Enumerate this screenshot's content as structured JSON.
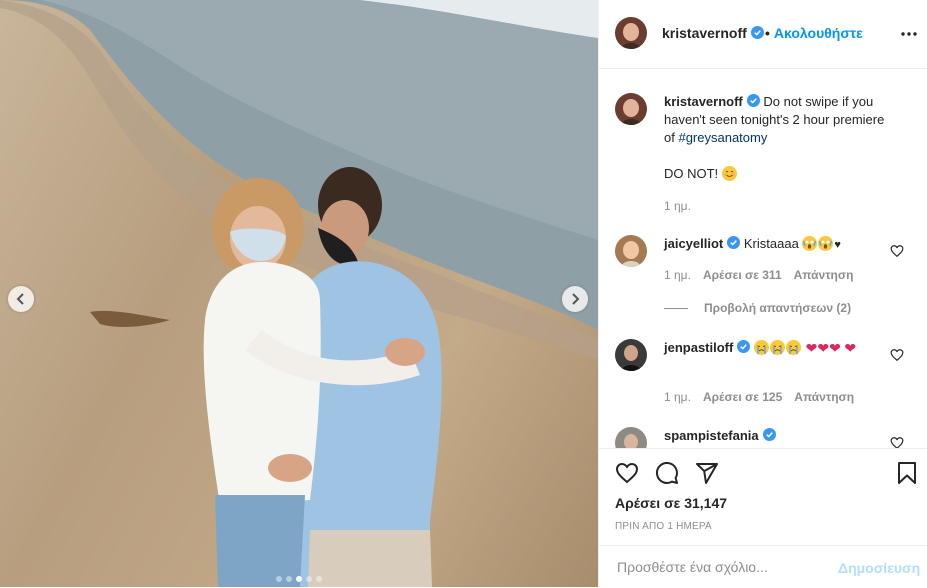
{
  "post": {
    "username": "kristavernoff",
    "follow_label": "Ακολουθήστε",
    "bullet": "•"
  },
  "caption": {
    "username": "kristavernoff",
    "text_before": "Do not swipe if you haven't seen tonight's 2 hour premiere of ",
    "hashtag": "#greysanatomy",
    "second_line": "DO NOT!",
    "time": "1 ημ."
  },
  "comments": [
    {
      "username": "jaicyelliot",
      "text": "Kristaaaa",
      "emojis": [
        "scream",
        "scream",
        "black-heart"
      ],
      "time": "1 ημ.",
      "likes": "Αρέσει σε 311",
      "reply": "Απάντηση",
      "view_replies": "Προβολή απαντήσεων (2)"
    },
    {
      "username": "jenpastiloff",
      "emojis": [
        "cry",
        "cry",
        "cry",
        "red-heart",
        "red-heart",
        "red-heart",
        "red-heart"
      ],
      "time": "1 ημ.",
      "likes": "Αρέσει σε 125",
      "reply": "Απάντηση"
    },
    {
      "username": "spampistefania"
    }
  ],
  "footer": {
    "likes": "Αρέσει σε 31,147",
    "time": "ΠΡΙΝ ΑΠΟ 1 ΗΜΕΡΑ",
    "comment_placeholder": "Προσθέστε ένα σχόλιο...",
    "post_label": "Δημοσίευση"
  },
  "carousel": {
    "slide_count": 5,
    "active_index": 2
  },
  "colors": {
    "accent": "#0095f6",
    "verified": "#3897f0",
    "muted": "#8e8e8e",
    "hashtag": "#00376b",
    "post_disabled": "#b2dffc"
  },
  "icons": [
    "verified-badge-icon",
    "more-options-icon",
    "heart-icon",
    "comment-icon",
    "share-icon",
    "bookmark-icon",
    "chevron-left-icon",
    "chevron-right-icon"
  ]
}
